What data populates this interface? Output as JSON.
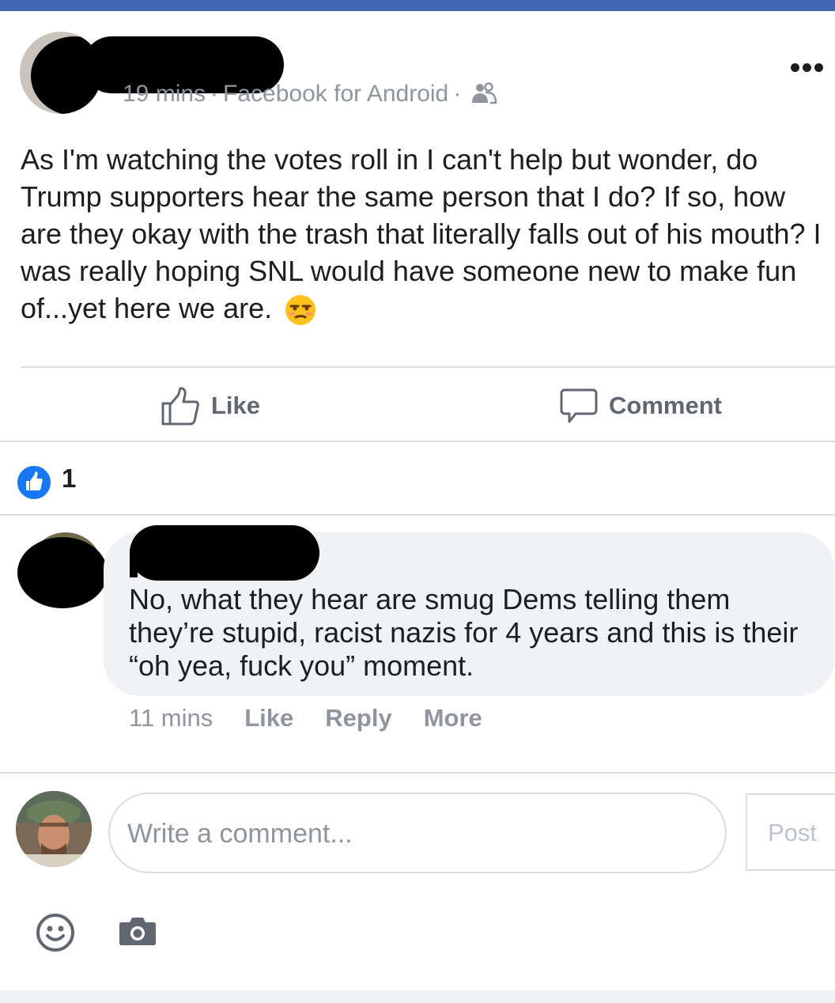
{
  "post": {
    "meta_time": "19 mins",
    "meta_source": "Facebook for Android",
    "meta_sep": "·",
    "privacy_icon": "friends-icon",
    "more_icon": "more-dots-icon",
    "text": "As I'm watching the votes roll in I can't help but wonder, do Trump supporters hear the same person that I do? If so, how are they okay with the trash that literally falls out of his mouth? I was really hoping SNL would have someone new to make fun of...yet here we are.",
    "emoji": "unamused-face-emoji"
  },
  "actions": {
    "like_label": "Like",
    "comment_label": "Comment"
  },
  "reactions": {
    "count": "1",
    "icon": "like-thumb-icon"
  },
  "comment": {
    "text": "No, what they hear are smug Dems telling them they’re stupid, racist nazis for 4 years and this is their “oh yea, fuck you” moment.",
    "time": "11 mins",
    "like_label": "Like",
    "reply_label": "Reply",
    "more_label": "More"
  },
  "composer": {
    "placeholder": "Write a comment...",
    "post_label": "Post",
    "emoji_icon": "smile-icon",
    "camera_icon": "camera-icon"
  },
  "colors": {
    "brand": "#4267b2",
    "like_blue": "#1877f2",
    "muted_text": "#90949c",
    "bubble": "#f0f2f5"
  }
}
